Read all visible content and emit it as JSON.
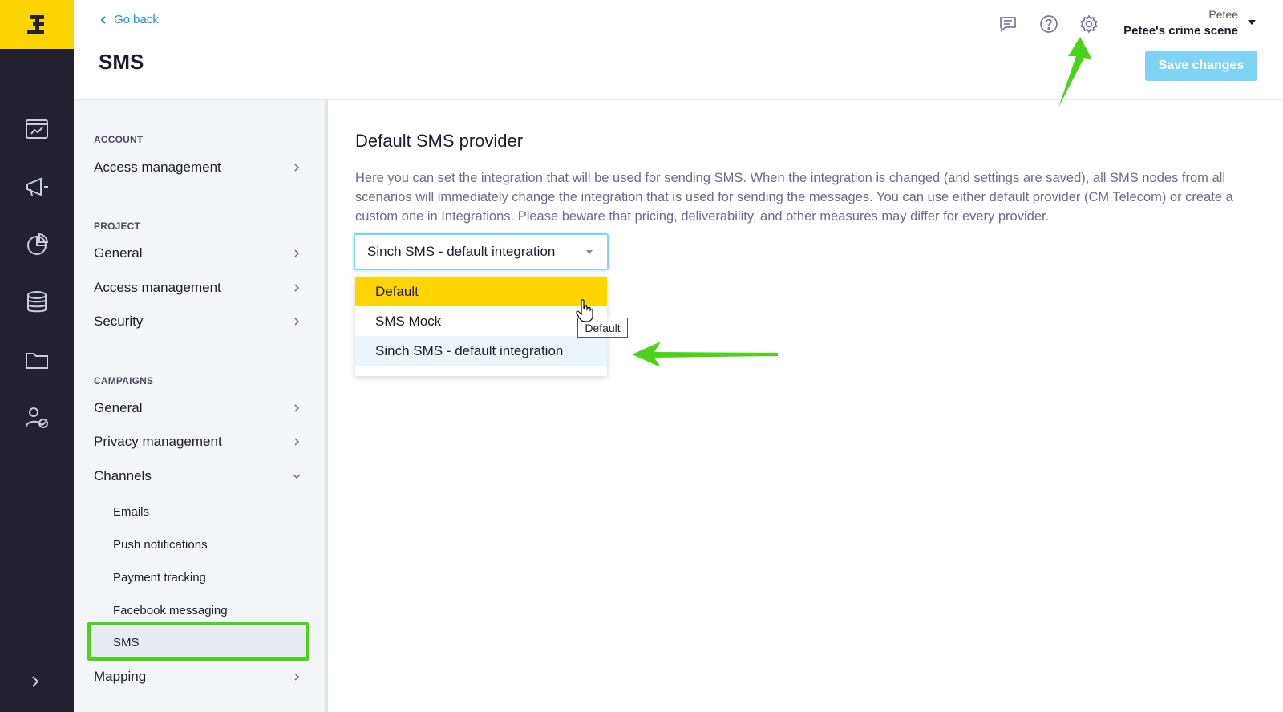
{
  "brand": {
    "logo_glyph": "Ɛ",
    "accent": "#ffd500",
    "rail_bg": "#23212f"
  },
  "header": {
    "back_label": "Go back",
    "page_title": "SMS",
    "user_name": "Petee",
    "project_name": "Petee's crime scene",
    "save_label": "Save changes",
    "icons": [
      "chat-icon",
      "help-icon",
      "settings-icon"
    ]
  },
  "rail": {
    "icons": [
      "dashboard-icon",
      "campaigns-icon",
      "analytics-icon",
      "data-icon",
      "assets-icon",
      "users-icon",
      "expand-icon"
    ]
  },
  "sidebar": {
    "account_label": "ACCOUNT",
    "account_items": [
      "Access management"
    ],
    "project_label": "PROJECT",
    "project_items": [
      "General",
      "Access management",
      "Security"
    ],
    "campaigns_label": "CAMPAIGNS",
    "campaigns_items": [
      "General",
      "Privacy management",
      "Channels"
    ],
    "channels": [
      "Emails",
      "Push notifications",
      "Payment tracking",
      "Facebook messaging",
      "SMS"
    ],
    "active_channel": "SMS",
    "mapping_label": "Mapping"
  },
  "main": {
    "title": "Default SMS provider",
    "description": "Here you can set the integration that will be used for sending SMS. When the integration is changed (and settings are saved), all SMS nodes from all scenarios will immediately change the integration that is used for sending the messages. You can use either default provider (CM Telecom) or create a custom one in Integrations. Please beware that pricing, deliverability, and other measures may differ for every provider.",
    "select_value": "Sinch SMS - default integration",
    "options": [
      "Default",
      "SMS Mock",
      "Sinch SMS - default integration"
    ],
    "tooltip": "Default"
  },
  "annotation_color": "#4bd219"
}
